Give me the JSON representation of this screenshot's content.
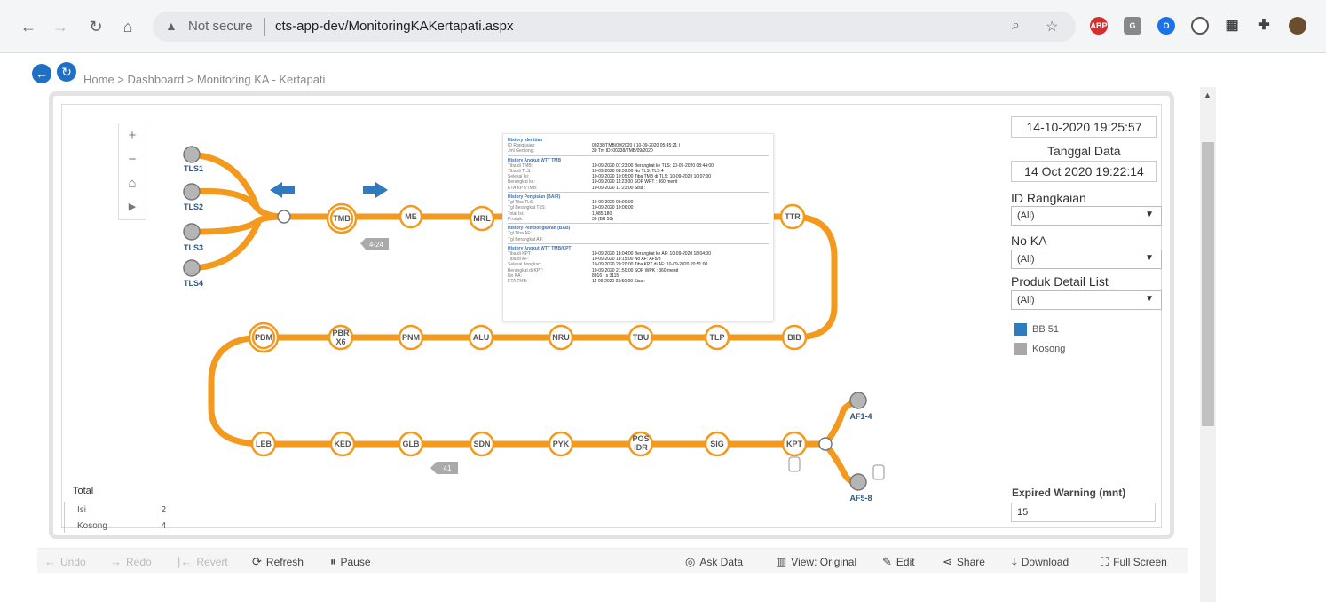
{
  "browser": {
    "security_label": "Not secure",
    "url": "cts-app-dev/MonitoringKAKertapati.aspx",
    "extensions": [
      "ABP",
      "G",
      "O",
      "Q",
      "grid-icon",
      "puzzle-icon",
      "avatar"
    ]
  },
  "breadcrumb": "Home > Dashboard > Monitoring KA - Kertapati",
  "map": {
    "nodes": {
      "TLS1": "TLS1",
      "TLS2": "TLS2",
      "TLS3": "TLS3",
      "TLS4": "TLS4",
      "TMB": "TMB",
      "ME": "ME",
      "MRL": "MRL",
      "TTR": "TTR",
      "PBM": "PBM",
      "PBRX6a": "PBR",
      "PBRX6b": "X6",
      "PNM": "PNM",
      "ALU": "ALU",
      "NRU": "NRU",
      "TBU": "TBU",
      "TLP": "TLP",
      "BIB": "BIB",
      "LEB": "LEB",
      "KED": "KED",
      "GLB": "GLB",
      "SDN": "SDN",
      "PYK": "PYK",
      "POSa": "POS",
      "POSb": "IDR",
      "SIG": "SIG",
      "KPT": "KPT",
      "AF14": "AF1-4",
      "AF58": "AF5-8"
    },
    "badge_top": "4-24",
    "badge_bottom": "41"
  },
  "tooltip": {
    "sections": [
      {
        "title": "History Identitas",
        "rows": [
          [
            "ID Rangkaian:",
            "00238/TMB/09/2020  ( 10-09-2020 05:45:21 )"
          ],
          [
            "Jml Gerbong:",
            "30    Trn ID:  00238/TMB/09/2020"
          ]
        ]
      },
      {
        "title": "History Angkut WTT TMB",
        "rows": [
          [
            "Tiba di TMB:",
            "10-09-2020 07:23:00  Berangkat ke TLS:  10-09-2020 08:44:00"
          ],
          [
            "Tiba di TLS:",
            "10-09-2020 08:59:00  No TLS: TLS 4"
          ],
          [
            "Selesai Isi:",
            "10-09-2020 10:05:00  Tiba TMB di TLS:  10-09-2020 10:07:00"
          ],
          [
            "Berangkat ke:",
            "10-09-2020 11:23:00  SOP WPT :  360 menit"
          ],
          [
            "ETA KPT/TMB:",
            "10-09-2020 17:23:00   Sisa :"
          ]
        ]
      },
      {
        "title": "History Pengisian (BAIR)",
        "rows": [
          [
            "Tgl Tiba TLS:",
            "10-09-2020 09:00:00"
          ],
          [
            "Tgl Berangkat TLS:",
            "10-09-2020 10:06:00"
          ],
          [
            "Total Isi:",
            "1,485,180"
          ],
          [
            "Produk:",
            "30 (BB 50)"
          ]
        ]
      },
      {
        "title": "History Pembongkaran (BAB)",
        "rows": [
          [
            "Tgl Tiba AF:",
            ""
          ],
          [
            "Tgl Berangkat AF:",
            ""
          ]
        ]
      },
      {
        "title": "History Angkut WTT TMB/KPT",
        "rows": [
          [
            "Tiba di KPT:",
            "10-09-2020 18:04:00  Berangkat ke AF:  10-09-2020 18:04:00"
          ],
          [
            "Tiba di AF:",
            "10-09-2020 18:15:00  No AF:  AF5/8"
          ],
          [
            "Selesai bongkar:",
            "10-09-2020 20:20:00  Tiba KPT di AF:  10-09-2020 20:51:00"
          ],
          [
            "Berangkat di KPT:",
            "10-09-2020 21:50:00  SOP WPK :  360 menit"
          ],
          [
            "No KA:",
            "8016 - s 3115"
          ],
          [
            "ETA TMB:",
            "11-09-2020 03:50:00   Sisa :"
          ]
        ]
      }
    ]
  },
  "filters": {
    "timestamp": "14-10-2020 19:25:57",
    "tanggal_label": "Tanggal Data",
    "tanggal_value": "14 Oct 2020 19:22:14",
    "id_rangkaian_label": "ID Rangkaian",
    "id_rangkaian_value": "(All)",
    "no_ka_label": "No KA",
    "no_ka_value": "(All)",
    "produk_label": "Produk Detail List",
    "produk_value": "(All)",
    "legend": [
      {
        "label": "BB 51",
        "color": "#2e7bbf"
      },
      {
        "label": "Kosong",
        "color": "#a8a8a8"
      }
    ],
    "expired_label": "Expired Warning (mnt)",
    "expired_value": "15"
  },
  "total": {
    "title": "Total",
    "rows": [
      {
        "label": "Isi",
        "value": "2"
      },
      {
        "label": "Kosong",
        "value": "4"
      }
    ]
  },
  "toolbar": {
    "undo": "Undo",
    "redo": "Redo",
    "revert": "Revert",
    "refresh": "Refresh",
    "pause": "Pause",
    "ask_data": "Ask Data",
    "view": "View: Original",
    "edit": "Edit",
    "share": "Share",
    "download": "Download",
    "full_screen": "Full Screen"
  },
  "colors": {
    "track": "#f39a1e",
    "node_fill": "#ffffff",
    "node_label": "#555555",
    "gray_node": "#8e8e8e",
    "accent_blue": "#2e7bbf"
  }
}
